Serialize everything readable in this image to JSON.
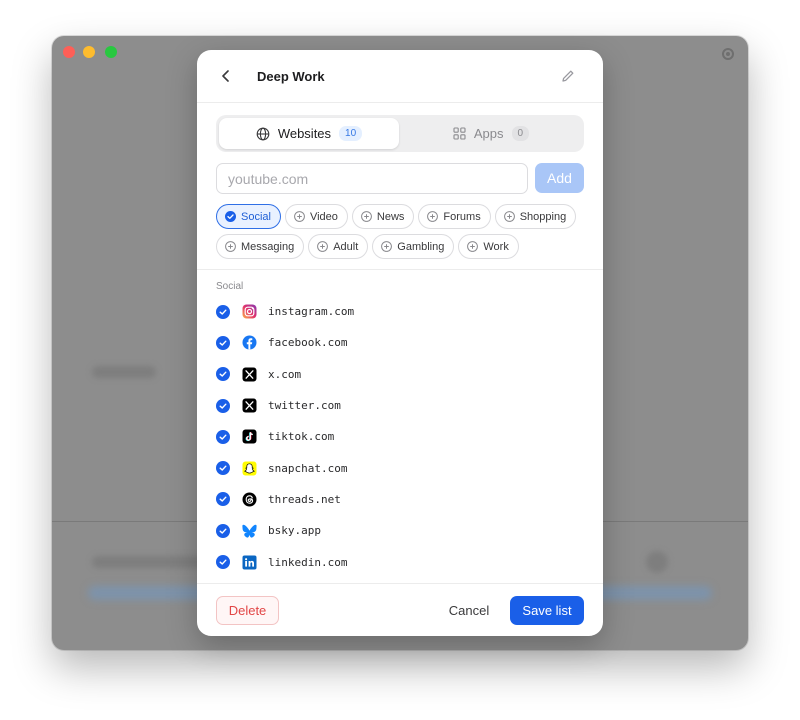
{
  "modal": {
    "title": "Deep Work",
    "tabs": [
      {
        "label": "Websites",
        "count": "10",
        "active": true
      },
      {
        "label": "Apps",
        "count": "0",
        "active": false
      }
    ],
    "input": {
      "placeholder": "youtube.com",
      "value": ""
    },
    "add_label": "Add",
    "categories": [
      {
        "label": "Social",
        "selected": true
      },
      {
        "label": "Video",
        "selected": false
      },
      {
        "label": "News",
        "selected": false
      },
      {
        "label": "Forums",
        "selected": false
      },
      {
        "label": "Shopping",
        "selected": false
      },
      {
        "label": "Messaging",
        "selected": false
      },
      {
        "label": "Adult",
        "selected": false
      },
      {
        "label": "Gambling",
        "selected": false
      },
      {
        "label": "Work",
        "selected": false
      }
    ],
    "section_label": "Social",
    "sites": [
      {
        "domain": "instagram.com",
        "icon": "instagram-icon",
        "checked": true
      },
      {
        "domain": "facebook.com",
        "icon": "facebook-icon",
        "checked": true
      },
      {
        "domain": "x.com",
        "icon": "x-icon",
        "checked": true
      },
      {
        "domain": "twitter.com",
        "icon": "x-icon",
        "checked": true
      },
      {
        "domain": "tiktok.com",
        "icon": "tiktok-icon",
        "checked": true
      },
      {
        "domain": "snapchat.com",
        "icon": "snapchat-icon",
        "checked": true
      },
      {
        "domain": "threads.net",
        "icon": "threads-icon",
        "checked": true
      },
      {
        "domain": "bsky.app",
        "icon": "bluesky-icon",
        "checked": true
      },
      {
        "domain": "linkedin.com",
        "icon": "linkedin-icon",
        "checked": true
      }
    ],
    "footer": {
      "delete_label": "Delete",
      "cancel_label": "Cancel",
      "save_label": "Save list"
    }
  },
  "colors": {
    "accent": "#1a5fe8",
    "danger": "#e24646",
    "add_disabled": "#a9c6f7"
  }
}
